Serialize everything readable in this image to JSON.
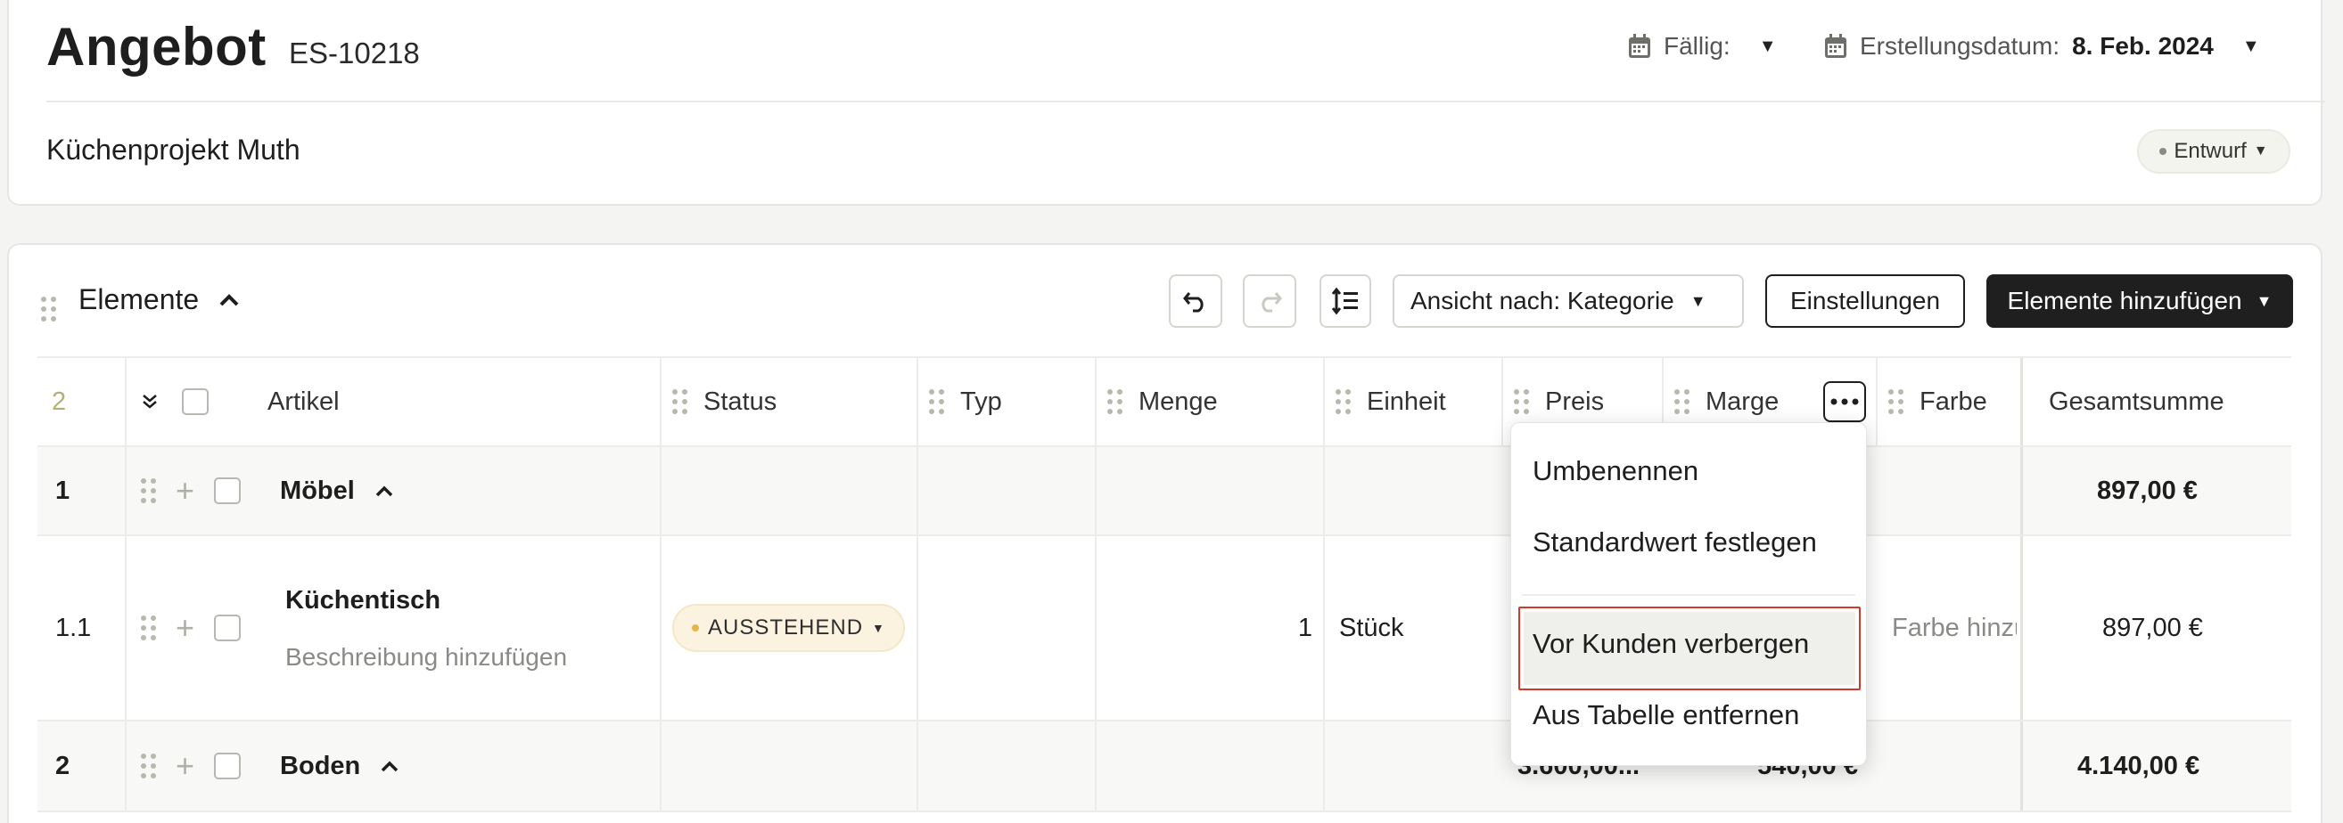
{
  "header": {
    "title": "Angebot",
    "number": "ES-10218",
    "due_label": "Fällig:",
    "created_label": "Erstellungsdatum:",
    "created_value": "8. Feb. 2024",
    "project": "Küchenprojekt Muth",
    "status": "Entwurf"
  },
  "section": {
    "title": "Elemente",
    "view_by": "Ansicht nach: Kategorie",
    "settings": "Einstellungen",
    "add_items": "Elemente hinzufügen"
  },
  "table": {
    "count": "2",
    "columns": [
      "Artikel",
      "Status",
      "Typ",
      "Menge",
      "Einheit",
      "Preis",
      "Marge",
      "Farbe",
      "Gesamtsumme"
    ],
    "rows": [
      {
        "no": "1",
        "name": "Möbel",
        "total": "897,00 €"
      },
      {
        "no": "1.1",
        "name": "Küchentisch",
        "description": "Beschreibung hinzufügen",
        "status": "AUSSTEHEND",
        "quantity": "1",
        "unit": "Stück",
        "color": "Farbe hinzu.",
        "total": "897,00 €"
      },
      {
        "no": "2",
        "name": "Boden",
        "price": "3.600,00...",
        "margin": "540,00 €",
        "total": "4.140,00 €"
      }
    ]
  },
  "column_menu": {
    "items": [
      "Umbenennen",
      "Standardwert festlegen",
      "Vor Kunden verbergen",
      "Aus Tabelle entfernen"
    ]
  },
  "colors": {
    "primary_button": "#1f1f1f",
    "highlight_border": "#d2392b",
    "pending_badge": "#fbf3df"
  }
}
